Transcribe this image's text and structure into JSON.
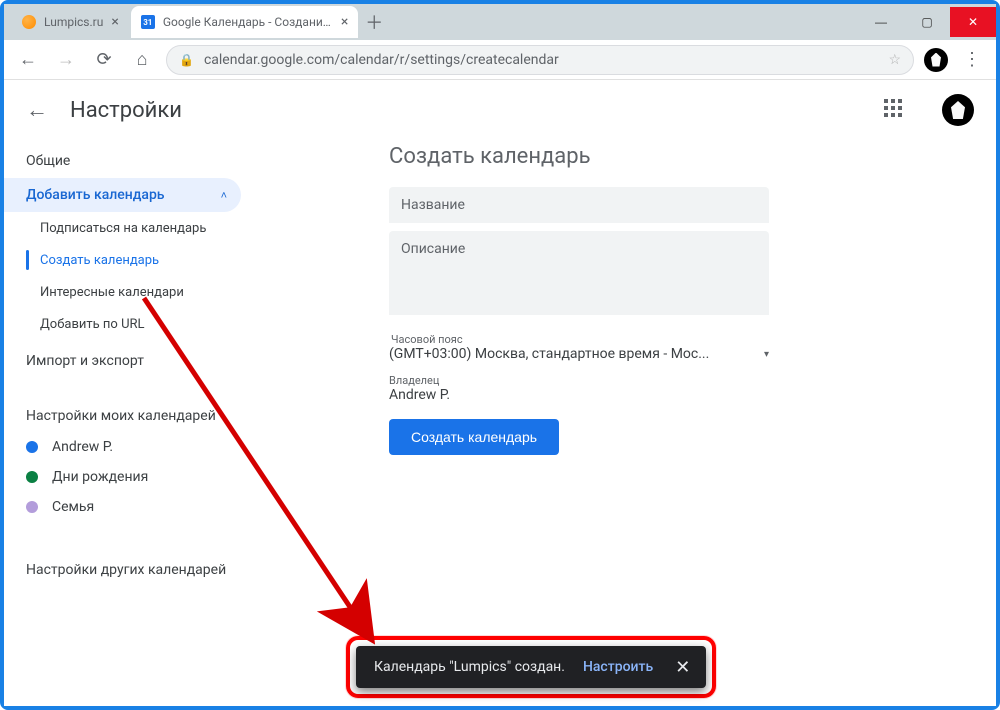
{
  "browser": {
    "tabs": [
      {
        "label": "Lumpics.ru",
        "active": false,
        "favicon": "lumpics"
      },
      {
        "label": "Google Календарь - Создание к",
        "active": true,
        "favicon": "gcal",
        "badge": "31"
      }
    ],
    "newtab_glyph": "＋",
    "win": {
      "min": "—",
      "max": "▢",
      "close": "✕"
    },
    "nav": {
      "back": "←",
      "fwd": "→",
      "reload": "⟳",
      "home": "⌂"
    },
    "url": "calendar.google.com/calendar/r/settings/createcalendar",
    "star": "☆",
    "menu": "⋮"
  },
  "app": {
    "back": "←",
    "title": "Настройки"
  },
  "sidebar": {
    "general": "Общие",
    "add_calendar": "Добавить календарь",
    "chevron": "˄",
    "sub": {
      "subscribe": "Подписаться на календарь",
      "create": "Создать календарь",
      "interesting": "Интересные календари",
      "byurl": "Добавить по URL"
    },
    "import_export": "Импорт и экспорт",
    "my_cal_hdr": "Настройки моих календарей",
    "cals": [
      {
        "name": "Andrew P.",
        "color": "#1a73e8"
      },
      {
        "name": "Дни рождения",
        "color": "#0b8043"
      },
      {
        "name": "Семья",
        "color": "#b39ddb"
      }
    ],
    "other_cal_hdr": "Настройки других календарей"
  },
  "panel": {
    "title": "Создать календарь",
    "name_ph": "Название",
    "desc_ph": "Описание",
    "tz_label": "Часовой пояс",
    "tz_value": "(GMT+03:00) Москва, стандартное время - Мос...",
    "tz_caret": "▾",
    "owner_label": "Владелец",
    "owner_value": "Andrew P.",
    "button": "Создать календарь"
  },
  "toast": {
    "text": "Календарь \"Lumpics\" создан.",
    "action": "Настроить",
    "close": "✕"
  }
}
